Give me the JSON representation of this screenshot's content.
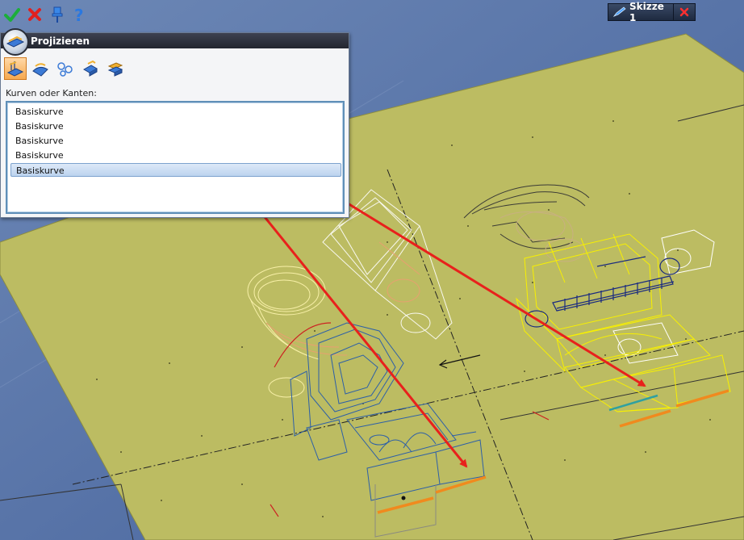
{
  "toolbar": {
    "confirm": "confirm-check-icon",
    "cancel": "cancel-x-icon",
    "pin": "pin-icon",
    "help": "help-question-icon"
  },
  "sketch_tab": {
    "label": "Skizze 1"
  },
  "panel": {
    "title": "Projizieren",
    "list_label": "Kurven oder Kanten:",
    "items": [
      {
        "label": "Basiskurve"
      },
      {
        "label": "Basiskurve"
      },
      {
        "label": "Basiskurve"
      },
      {
        "label": "Basiskurve"
      },
      {
        "label": "Basiskurve"
      }
    ],
    "selected_index": 4
  },
  "colors": {
    "sketch_plane": "#bcbc62",
    "background": "#5a78a8",
    "annotation_arrow": "#e8211c",
    "projected_edge": "#f08a1e",
    "selection_highlight": "#bcd3ee"
  }
}
